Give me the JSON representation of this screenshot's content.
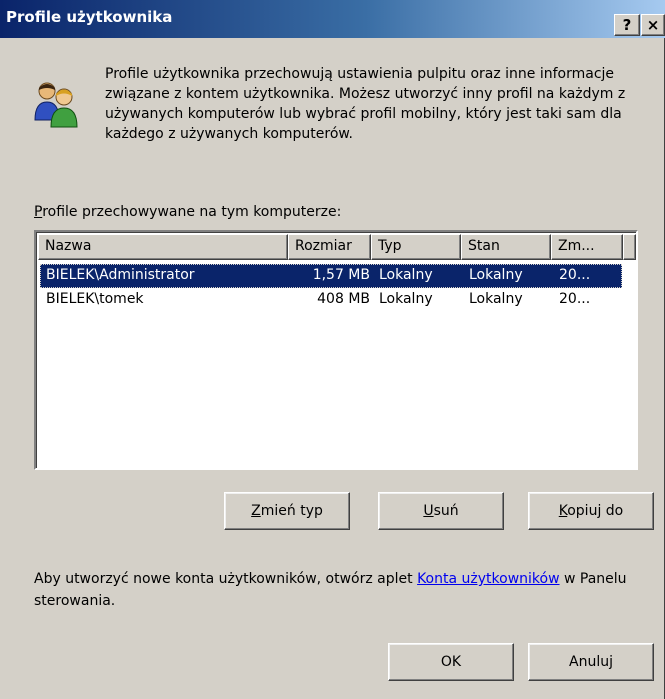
{
  "window": {
    "title": "Profile użytkownika",
    "help_label": "?",
    "close_label": "×"
  },
  "description": "Profile użytkownika przechowują ustawienia pulpitu oraz inne informacje związane z kontem użytkownika. Możesz utworzyć inny profil na każdym z używanych komputerów lub wybrać profil mobilny, który jest taki sam dla każdego z używanych komputerów.",
  "profiles_label": {
    "accel": "P",
    "rest": "rofile przechowywane na tym komputerze:"
  },
  "list": {
    "columns": [
      "Nazwa",
      "Rozmiar",
      "Typ",
      "Stan",
      "Zm..."
    ],
    "rows": [
      [
        "BIELEK\\Administrator",
        "1,57 MB",
        "Lokalny",
        "Lokalny",
        "20..."
      ],
      [
        "BIELEK\\tomek",
        "408 MB",
        "Lokalny",
        "Lokalny",
        "20..."
      ]
    ],
    "selected_index": 0
  },
  "buttons": {
    "change_type": {
      "accel": "Z",
      "rest": "mień typ"
    },
    "delete": {
      "accel": "U",
      "rest": "suń"
    },
    "copy_to": {
      "accel": "K",
      "rest": "opiuj do"
    },
    "ok": "OK",
    "cancel": "Anuluj"
  },
  "info": {
    "before": "Aby utworzyć nowe konta użytkowników, otwórz aplet ",
    "link": "Konta użytkowników",
    "after": " w Panelu sterowania."
  }
}
